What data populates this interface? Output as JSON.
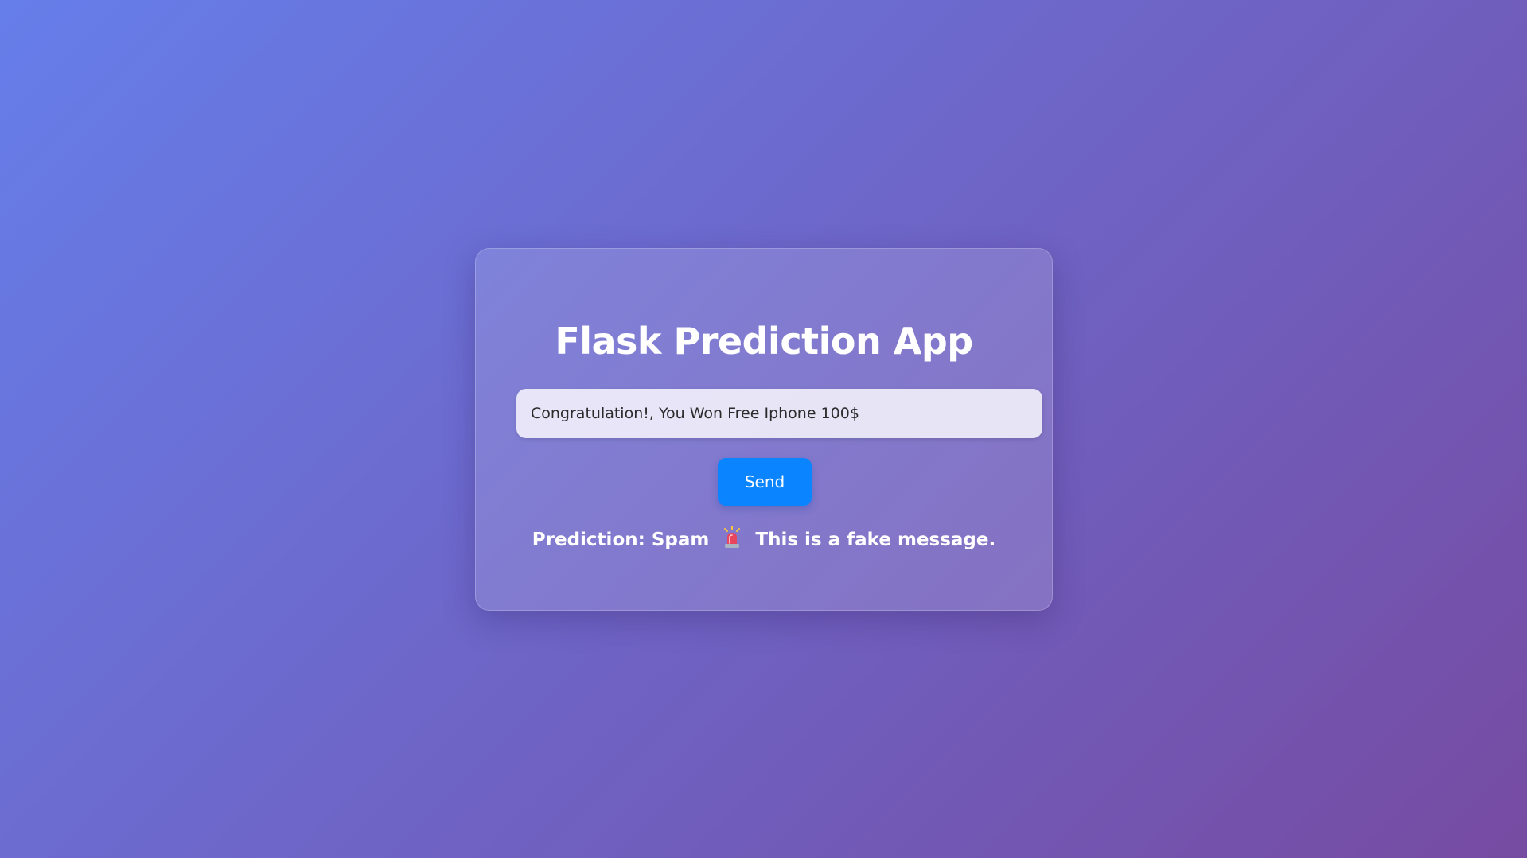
{
  "app": {
    "title": "Flask Prediction App"
  },
  "form": {
    "message_value": "Congratulation!, You Won Free Iphone 100$",
    "send_label": "Send"
  },
  "result": {
    "prefix": "Prediction: Spam",
    "icon": "siren-icon",
    "suffix": "This is a fake message."
  },
  "colors": {
    "background_start": "#667eea",
    "background_end": "#764ba2",
    "button": "#0a84ff",
    "text": "#ffffff"
  }
}
